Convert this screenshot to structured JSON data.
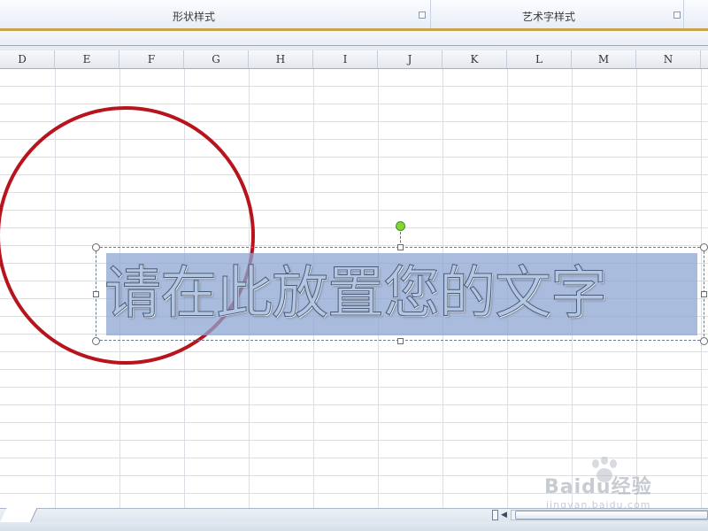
{
  "ribbon": {
    "groups": [
      {
        "label": "形状样式"
      },
      {
        "label": "艺术字样式"
      }
    ]
  },
  "columns": [
    "D",
    "E",
    "F",
    "G",
    "H",
    "I",
    "J",
    "K",
    "L",
    "M",
    "N"
  ],
  "wordart": {
    "text": "请在此放置您的文字",
    "fill_color": "#b3c6e4",
    "outline_color": "#4d5c74",
    "selection_highlight": "#8ca5d2"
  },
  "shapes": {
    "circle": {
      "stroke_color": "#b8141e"
    }
  },
  "watermark": {
    "brand": "Baidu经验",
    "domain": "jingyan.baidu.com"
  },
  "colors": {
    "ribbon_accent": "#c8a24c",
    "grid_line": "#dadfe6",
    "rotation_handle": "#7ed63a"
  }
}
